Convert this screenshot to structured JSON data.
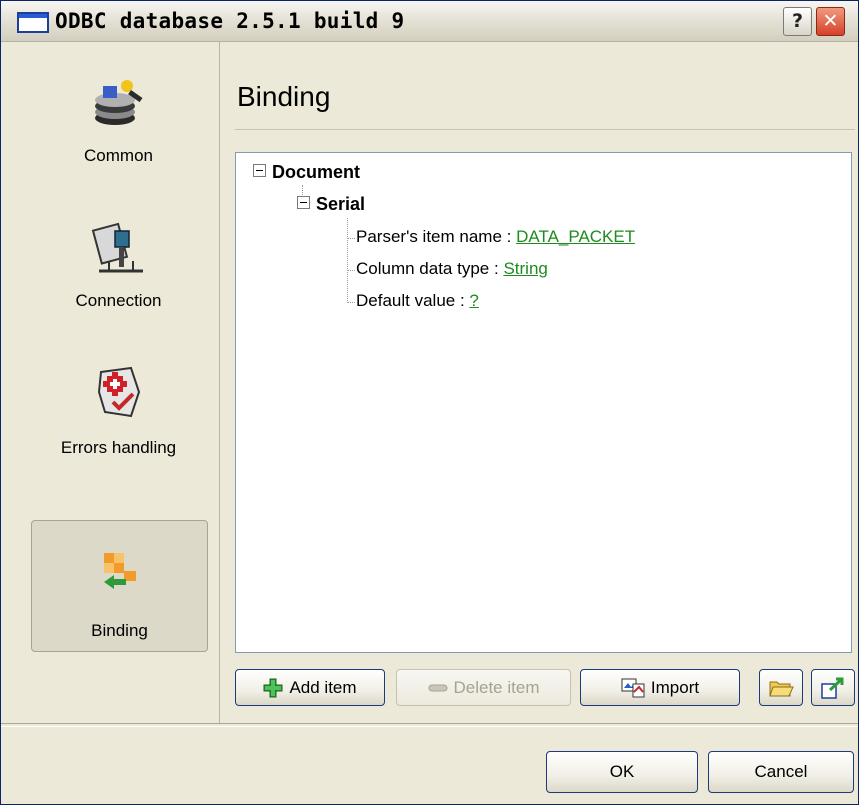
{
  "window": {
    "title": "ODBC database 2.5.1 build 9",
    "help_label": "?",
    "close_label": "✕"
  },
  "sidebar": {
    "items": [
      {
        "label": "Common",
        "icon": "common-settings-icon"
      },
      {
        "label": "Connection",
        "icon": "connection-icon"
      },
      {
        "label": "Errors handling",
        "icon": "errors-handling-icon"
      },
      {
        "label": "Binding",
        "icon": "binding-icon",
        "selected": true
      }
    ]
  },
  "panel": {
    "title": "Binding"
  },
  "tree": {
    "root": "Document",
    "child": "Serial",
    "props": [
      {
        "label": "Parser's item name :",
        "value": "DATA_PACKET"
      },
      {
        "label": "Column data type :",
        "value": "String"
      },
      {
        "label": "Default value  :",
        "value": "?"
      }
    ]
  },
  "toolbar": {
    "add": "Add item",
    "delete": "Delete item",
    "import": "Import"
  },
  "footer": {
    "ok": "OK",
    "cancel": "Cancel"
  }
}
